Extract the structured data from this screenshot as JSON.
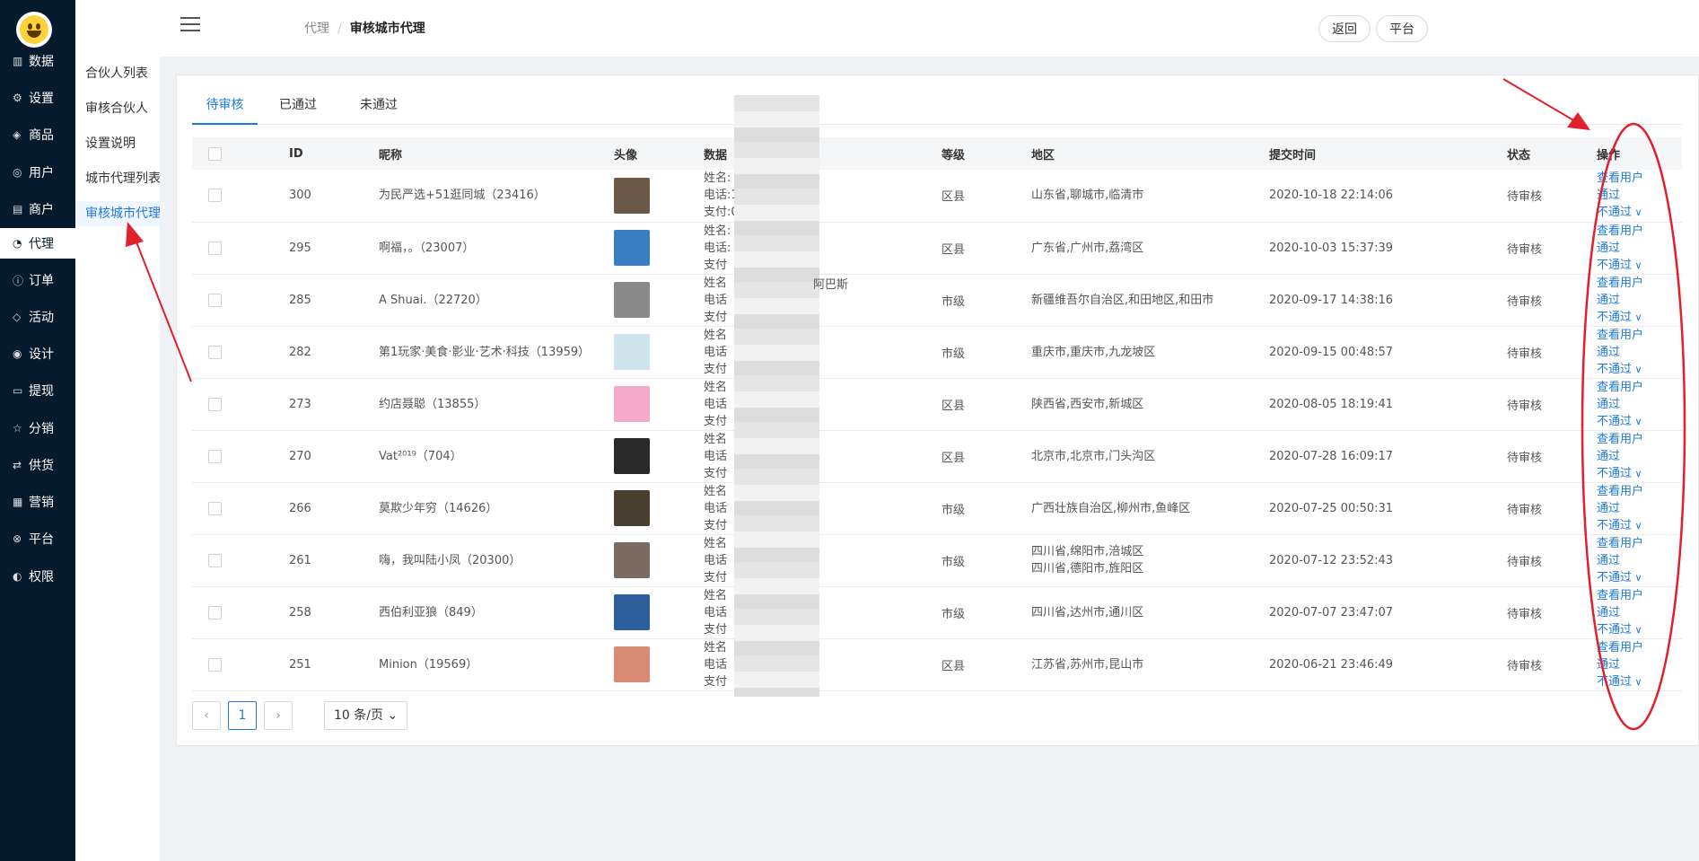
{
  "sidebar": {
    "items": [
      {
        "label": "数据",
        "icon": "bar-chart-icon",
        "glyph": "▥"
      },
      {
        "label": "设置",
        "icon": "gear-icon",
        "glyph": "⚙"
      },
      {
        "label": "商品",
        "icon": "box-icon",
        "glyph": "◈"
      },
      {
        "label": "用户",
        "icon": "user-icon",
        "glyph": "◎"
      },
      {
        "label": "商户",
        "icon": "store-icon",
        "glyph": "▤"
      },
      {
        "label": "代理",
        "icon": "pie-icon",
        "glyph": "◔"
      },
      {
        "label": "订单",
        "icon": "info-icon",
        "glyph": "ⓘ"
      },
      {
        "label": "活动",
        "icon": "tag-icon",
        "glyph": "◇"
      },
      {
        "label": "设计",
        "icon": "palette-icon",
        "glyph": "◉"
      },
      {
        "label": "提现",
        "icon": "card-icon",
        "glyph": "▭"
      },
      {
        "label": "分销",
        "icon": "star-icon",
        "glyph": "☆"
      },
      {
        "label": "供货",
        "icon": "swap-icon",
        "glyph": "⇄"
      },
      {
        "label": "营销",
        "icon": "grid-icon",
        "glyph": "▦"
      },
      {
        "label": "平台",
        "icon": "globe-icon",
        "glyph": "⊗"
      },
      {
        "label": "权限",
        "icon": "compass-icon",
        "glyph": "◐"
      }
    ]
  },
  "subnav": {
    "items": [
      "合伙人列表",
      "审核合伙人",
      "设置说明",
      "城市代理列表",
      "审核城市代理"
    ]
  },
  "breadcrumb": {
    "first": "代理",
    "separator": "/",
    "current": "审核城市代理"
  },
  "header": {
    "back_label": "返回",
    "platform_label": "平台"
  },
  "tabs": [
    "待审核",
    "已通过",
    "未通过"
  ],
  "table": {
    "headers": [
      "ID",
      "昵称",
      "头像",
      "数据",
      "等级",
      "地区",
      "提交时间",
      "状态",
      "操作"
    ],
    "rows": [
      {
        "id": "300",
        "nickname": "为民严选+51逛同城（23416）",
        "avatar_color": "#6b5a4a",
        "data": [
          "姓名:",
          "电话:1",
          "支付:0."
        ],
        "level": "区县",
        "region": "山东省,聊城市,临清市",
        "time": "2020-10-18 22:14:06",
        "status": "待审核"
      },
      {
        "id": "295",
        "nickname": "啊福，。（23007）",
        "avatar_color": "#3a7fc1",
        "data": [
          "姓名:",
          "电话:",
          "支付"
        ],
        "level": "区县",
        "region": "广东省,广州市,荔湾区",
        "time": "2020-10-03 15:37:39",
        "status": "待审核"
      },
      {
        "id": "285",
        "nickname": "A Shuai.（22720）",
        "avatar_color": "#8a8a8a",
        "data": [
          "姓名",
          "电话",
          "支付"
        ],
        "level": "市级",
        "region": "新疆维吾尔自治区,和田地区,和田市",
        "time": "2020-09-17 14:38:16",
        "status": "待审核"
      },
      {
        "id": "282",
        "nickname": "第1玩家·美食·影业·艺术·科技（13959）",
        "avatar_color": "#cfe3ea",
        "data": [
          "姓名",
          "电话",
          "支付"
        ],
        "level": "市级",
        "region": "重庆市,重庆市,九龙坡区",
        "time": "2020-09-15 00:48:57",
        "status": "待审核"
      },
      {
        "id": "273",
        "nickname": "约店聂聪（13855）",
        "avatar_color": "#f4a9c8",
        "data": [
          "姓名",
          "电话",
          "支付"
        ],
        "level": "区县",
        "region": "陕西省,西安市,新城区",
        "time": "2020-08-05 18:19:41",
        "status": "待审核"
      },
      {
        "id": "270",
        "nickname": "Vat²⁰¹⁹（704）",
        "avatar_color": "#2a2a2a",
        "data": [
          "姓名",
          "电话",
          "支付"
        ],
        "level": "区县",
        "region": "北京市,北京市,门头沟区",
        "time": "2020-07-28 16:09:17",
        "status": "待审核"
      },
      {
        "id": "266",
        "nickname": "莫欺少年穷（14626）",
        "avatar_color": "#4a4032",
        "data": [
          "姓名",
          "电话",
          "支付"
        ],
        "level": "市级",
        "region": "广西壮族自治区,柳州市,鱼峰区",
        "time": "2020-07-25 00:50:31",
        "status": "待审核"
      },
      {
        "id": "261",
        "nickname": "嗨，我叫陆小凤（20300）",
        "avatar_color": "#7a6a62",
        "data": [
          "姓名",
          "电话",
          "支付"
        ],
        "level": "市级",
        "region": "四川省,绵阳市,涪城区\n四川省,德阳市,旌阳区",
        "time": "2020-07-12 23:52:43",
        "status": "待审核"
      },
      {
        "id": "258",
        "nickname": "西伯利亚狼（849）",
        "avatar_color": "#2d5d9a",
        "data": [
          "姓名",
          "电话",
          "支付"
        ],
        "level": "市级",
        "region": "四川省,达州市,通川区",
        "time": "2020-07-07 23:47:07",
        "status": "待审核"
      },
      {
        "id": "251",
        "nickname": "Minion（19569）",
        "avatar_color": "#d98a74",
        "data": [
          "姓名",
          "电话",
          "支付"
        ],
        "level": "区县",
        "region": "江苏省,苏州市,昆山市",
        "time": "2020-06-21 23:46:49",
        "status": "待审核"
      }
    ],
    "extra_data_text": "阿巴斯",
    "actions": {
      "view": "查看用户",
      "approve": "通过",
      "reject": "不通过"
    }
  },
  "pagination": {
    "prev": "‹",
    "current": "1",
    "next": "›",
    "page_size": "10 条/页"
  },
  "colors": {
    "sidebar_bg": "#061a2d",
    "accent": "#1f7ae0",
    "annotation": "#e0202a"
  }
}
